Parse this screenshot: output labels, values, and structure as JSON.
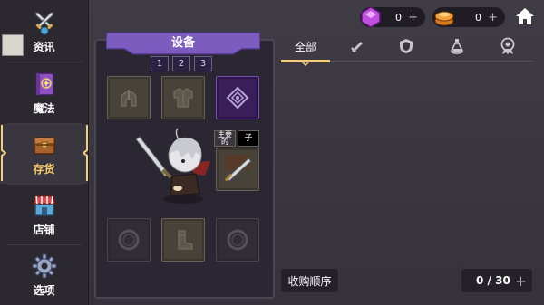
{
  "nav": {
    "items": [
      {
        "label": "资讯",
        "icon": "crossed-swords-icon"
      },
      {
        "label": "魔法",
        "icon": "spellbook-icon"
      },
      {
        "label": "存货",
        "icon": "treasure-chest-icon"
      },
      {
        "label": "店铺",
        "icon": "shop-icon"
      },
      {
        "label": "选项",
        "icon": "gear-icon"
      }
    ]
  },
  "equipment": {
    "title": "设备",
    "pages": [
      "1",
      "2",
      "3"
    ],
    "main_tag": "主要的",
    "secondary_tag": "子"
  },
  "tabs": {
    "all_label": "全部",
    "items": [
      "sword-icon",
      "shield-icon",
      "potion-icon",
      "medal-icon"
    ]
  },
  "currency": {
    "gems": "0",
    "coins": "0"
  },
  "sort_label": "收购顺序",
  "capacity": "0 / 30",
  "colors": {
    "accent": "#f3cf7a",
    "ribbon": "#7d5cc0"
  }
}
